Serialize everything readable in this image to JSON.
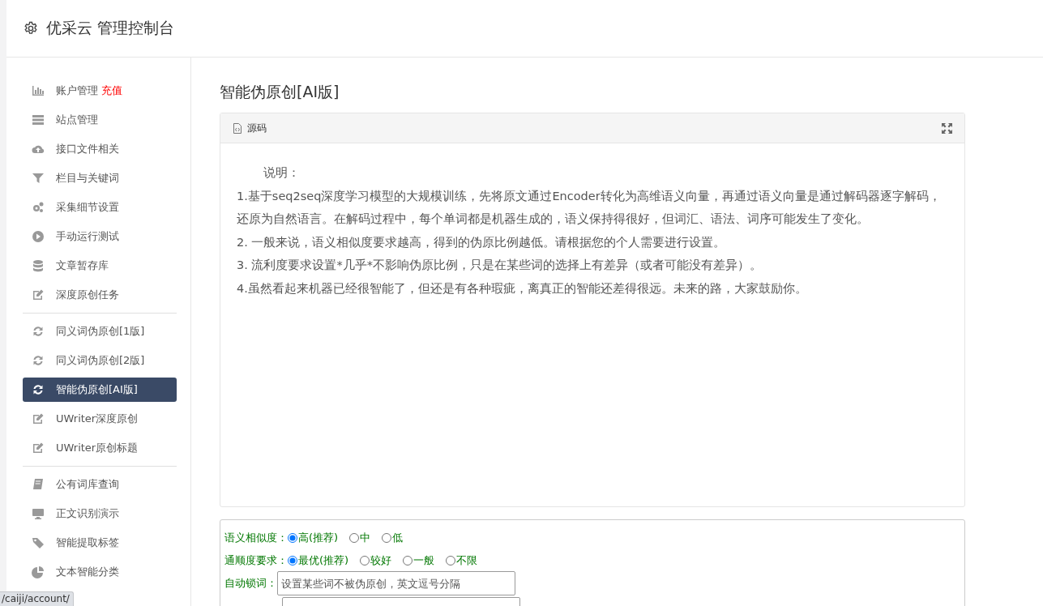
{
  "header": {
    "title": "优采云 管理控制台"
  },
  "sidebar": {
    "groups": [
      [
        {
          "label": "账户管理",
          "badge": "充值",
          "selected": false
        },
        {
          "label": "站点管理",
          "selected": false
        },
        {
          "label": "接口文件相关",
          "selected": false
        },
        {
          "label": "栏目与关键词",
          "selected": false
        },
        {
          "label": "采集细节设置",
          "selected": false
        },
        {
          "label": "手动运行测试",
          "selected": false
        },
        {
          "label": "文章暂存库",
          "selected": false
        },
        {
          "label": "深度原创任务",
          "selected": false
        }
      ],
      [
        {
          "label": "同义词伪原创[1版]",
          "selected": false
        },
        {
          "label": "同义词伪原创[2版]",
          "selected": false
        },
        {
          "label": "智能伪原创[AI版]",
          "selected": true
        },
        {
          "label": "UWriter深度原创",
          "selected": false
        },
        {
          "label": "UWriter原创标题",
          "selected": false
        }
      ],
      [
        {
          "label": "公有词库查询",
          "selected": false
        },
        {
          "label": "正文识别演示",
          "selected": false
        },
        {
          "label": "智能提取标签",
          "selected": false
        },
        {
          "label": "文本智能分类",
          "selected": false
        }
      ]
    ]
  },
  "page_title": "智能伪原创[AI版]",
  "source_panel": {
    "tab": "源码",
    "heading": "说明：",
    "paragraphs": [
      "1.基于seq2seq深度学习模型的大规模训练，先将原文通过Encoder转化为高维语义向量，再通过语义向量是通过解码器逐字解码，还原为自然语言。在解码过程中，每个单词都是机器生成的，语义保持得很好，但词汇、语法、词序可能发生了变化。",
      "2. 一般来说，语义相似度要求越高，得到的伪原比例越低。请根据您的个人需要进行设置。",
      "3. 流利度要求设置*几乎*不影响伪原比例，只是在某些词的选择上有差异（或者可能没有差异）。",
      "4.虽然看起来机器已经很智能了，但还是有各种瑕疵，离真正的智能还差得很远。未来的路，大家鼓励你。"
    ]
  },
  "options": [
    {
      "kind": "radio",
      "label": "语义相似度：",
      "choices": [
        {
          "label": "高(推荐)",
          "selected": true
        },
        {
          "label": "中",
          "selected": false
        },
        {
          "label": "低",
          "selected": false
        }
      ]
    },
    {
      "kind": "radio",
      "label": "通顺度要求：",
      "choices": [
        {
          "label": "最优(推荐)",
          "selected": true
        },
        {
          "label": "较好",
          "selected": false
        },
        {
          "label": "一般",
          "selected": false
        },
        {
          "label": "不限",
          "selected": false
        }
      ]
    },
    {
      "kind": "text",
      "label": "自动锁词：",
      "placeholder": "设置某些词不被伪原创，英文逗号分隔"
    }
  ],
  "status_url": "/caiji/account/"
}
